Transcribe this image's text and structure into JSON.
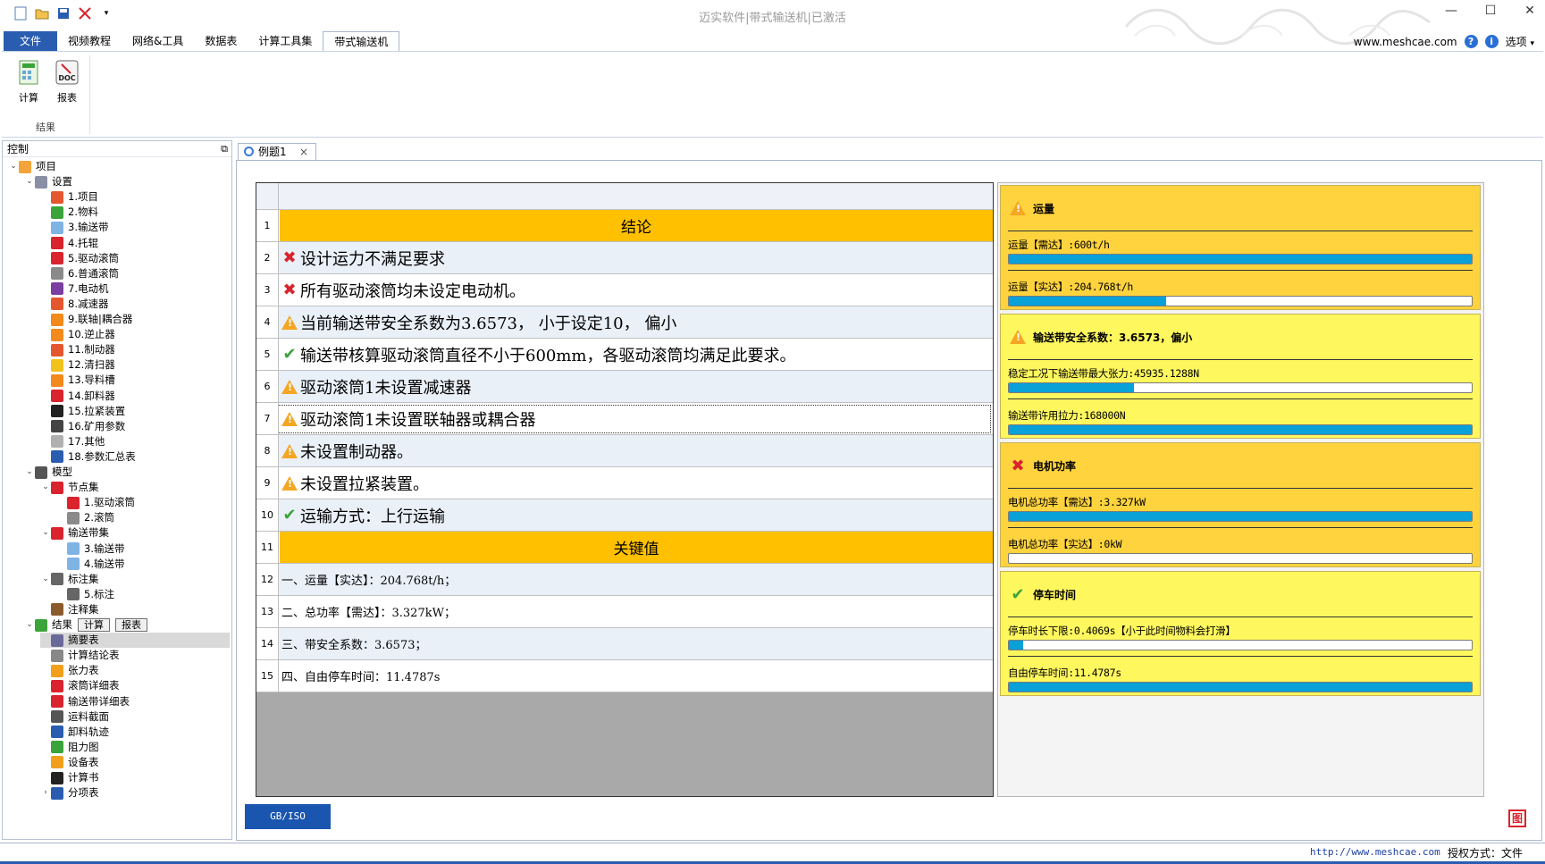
{
  "app_title": "迈实软件|带式输送机|已激活",
  "website": "www.meshcae.com",
  "options_label": "选项",
  "ribbon_tabs": [
    {
      "label": "文件"
    },
    {
      "label": "视频教程"
    },
    {
      "label": "网络&工具"
    },
    {
      "label": "数据表"
    },
    {
      "label": "计算工具集"
    },
    {
      "label": "带式输送机"
    }
  ],
  "ribbon": {
    "calc_label": "计算",
    "report_label": "报表",
    "doc_glyph": "DOC",
    "group_label": "结果"
  },
  "left_panel": {
    "title": "控制",
    "tree": [
      {
        "label": "项目",
        "level": 0,
        "arrow": "v",
        "color": "#f4a43a"
      },
      {
        "label": "设置",
        "level": 1,
        "arrow": "v",
        "color": "#8a8fa6"
      },
      {
        "label": "1.项目",
        "level": 2,
        "color": "#e4572e"
      },
      {
        "label": "2.物料",
        "level": 2,
        "color": "#3aa43a"
      },
      {
        "label": "3.输送带",
        "level": 2,
        "color": "#7fb3e6"
      },
      {
        "label": "4.托辊",
        "level": 2,
        "color": "#d9232d"
      },
      {
        "label": "5.驱动滚筒",
        "level": 2,
        "color": "#d9232d"
      },
      {
        "label": "6.普通滚筒",
        "level": 2,
        "color": "#8a8a8a"
      },
      {
        "label": "7.电动机",
        "level": 2,
        "color": "#7a3fa0"
      },
      {
        "label": "8.减速器",
        "level": 2,
        "color": "#e4572e"
      },
      {
        "label": "9.联轴|耦合器",
        "level": 2,
        "color": "#f28a1c"
      },
      {
        "label": "10.逆止器",
        "level": 2,
        "color": "#f28a1c"
      },
      {
        "label": "11.制动器",
        "level": 2,
        "color": "#e4572e"
      },
      {
        "label": "12.清扫器",
        "level": 2,
        "color": "#f2c21c"
      },
      {
        "label": "13.导料槽",
        "level": 2,
        "color": "#f28a1c"
      },
      {
        "label": "14.卸料器",
        "level": 2,
        "color": "#d9232d"
      },
      {
        "label": "15.拉紧装置",
        "level": 2,
        "color": "#222222"
      },
      {
        "label": "16.矿用参数",
        "level": 2,
        "color": "#444444"
      },
      {
        "label": "17.其他",
        "level": 2,
        "color": "#b0b0b0"
      },
      {
        "label": "18.参数汇总表",
        "level": 2,
        "color": "#2a5db0"
      },
      {
        "label": "模型",
        "level": 1,
        "arrow": "v",
        "color": "#555555"
      },
      {
        "label": "节点集",
        "level": 2,
        "arrow": "v",
        "color": "#d9232d"
      },
      {
        "label": "1.驱动滚筒",
        "level": 3,
        "color": "#d9232d"
      },
      {
        "label": "2.滚筒",
        "level": 3,
        "color": "#8a8a8a"
      },
      {
        "label": "输送带集",
        "level": 2,
        "arrow": "v",
        "color": "#d9232d"
      },
      {
        "label": "3.输送带",
        "level": 3,
        "color": "#7fb3e6"
      },
      {
        "label": "4.输送带",
        "level": 3,
        "color": "#7fb3e6"
      },
      {
        "label": "标注集",
        "level": 2,
        "arrow": "v",
        "color": "#666666"
      },
      {
        "label": "5.标注",
        "level": 3,
        "color": "#666666"
      },
      {
        "label": "注释集",
        "level": 2,
        "color": "#8b5a2b"
      },
      {
        "label": "结果",
        "level": 1,
        "arrow": "v",
        "color": "#3aa43a",
        "buttons": [
          "计算",
          "报表"
        ]
      },
      {
        "label": "摘要表",
        "level": 2,
        "color": "#6a6a9a",
        "selected": true
      },
      {
        "label": "计算结论表",
        "level": 2,
        "color": "#888888"
      },
      {
        "label": "张力表",
        "level": 2,
        "color": "#f2a01c"
      },
      {
        "label": "滚筒详细表",
        "level": 2,
        "color": "#d9232d"
      },
      {
        "label": "输送带详细表",
        "level": 2,
        "color": "#d9232d"
      },
      {
        "label": "运料截面",
        "level": 2,
        "color": "#555555"
      },
      {
        "label": "卸料轨迹",
        "level": 2,
        "color": "#2a5db0"
      },
      {
        "label": "阻力图",
        "level": 2,
        "color": "#3aa43a"
      },
      {
        "label": "设备表",
        "level": 2,
        "color": "#f2a01c"
      },
      {
        "label": "计算书",
        "level": 2,
        "color": "#222222"
      },
      {
        "label": "分项表",
        "level": 2,
        "arrow": ">",
        "color": "#2a5db0"
      }
    ]
  },
  "doc_tab": {
    "label": "例题1",
    "close": "×"
  },
  "grid": {
    "rows": [
      {
        "num": "1",
        "text": "结论",
        "type": "header"
      },
      {
        "num": "2",
        "text": "设计运力不满足要求",
        "icon": "x"
      },
      {
        "num": "3",
        "text": "所有驱动滚筒均未设定电动机。",
        "icon": "x"
      },
      {
        "num": "4",
        "text": "当前输送带安全系数为3.6573， 小于设定10， 偏小",
        "icon": "warn"
      },
      {
        "num": "5",
        "text": "输送带核算驱动滚筒直径不小于600mm，各驱动滚筒均满足此要求。",
        "icon": "check"
      },
      {
        "num": "6",
        "text": "驱动滚筒1未设置减速器",
        "icon": "warn"
      },
      {
        "num": "7",
        "text": "驱动滚筒1未设置联轴器或耦合器",
        "icon": "warn",
        "focus": true
      },
      {
        "num": "8",
        "text": "未设置制动器。",
        "icon": "warn"
      },
      {
        "num": "9",
        "text": "未设置拉紧装置。",
        "icon": "warn"
      },
      {
        "num": "10",
        "text": "运输方式：上行运输",
        "icon": "check"
      },
      {
        "num": "11",
        "text": "关键值",
        "type": "header"
      },
      {
        "num": "12",
        "text": "一、运量【实达】：204.768t/h；",
        "small": true
      },
      {
        "num": "13",
        "text": "二、总功率【需达】：3.327kW；",
        "small": true
      },
      {
        "num": "14",
        "text": "三、带安全系数：3.6573；",
        "small": true
      },
      {
        "num": "15",
        "text": "四、自由停车时间：11.4787s",
        "small": true
      }
    ]
  },
  "cards": [
    {
      "title": "运量",
      "icon": "warn",
      "color": "orange",
      "items": [
        {
          "label": "运量【需达】:600t/h",
          "fraction": 1.0
        },
        {
          "label": "运量【实达】:204.768t/h",
          "fraction": 0.34
        }
      ]
    },
    {
      "title": "输送带安全系数：3.6573，偏小",
      "icon": "warn",
      "color": "yellow",
      "items": [
        {
          "label": "稳定工况下输送带最大张力:45935.1288N",
          "fraction": 0.27
        },
        {
          "label": "输送带许用拉力:168000N",
          "fraction": 1.0
        }
      ]
    },
    {
      "title": "电机功率",
      "icon": "x",
      "color": "orange",
      "items": [
        {
          "label": "电机总功率【需达】:3.327kW",
          "fraction": 1.0
        },
        {
          "label": "电机总功率【实达】:0kW",
          "fraction": 0.0
        }
      ]
    },
    {
      "title": "停车时间",
      "icon": "check",
      "color": "yellow",
      "items": [
        {
          "label": "停车时长下限:0.4069s【小于此时间物料会打滑】",
          "fraction": 0.03
        },
        {
          "label": "自由停车时间:11.4787s",
          "fraction": 1.0
        }
      ]
    }
  ],
  "bottom": {
    "standard_label": "GB/ISO",
    "image_glyph": "图"
  },
  "status": {
    "url": "http://www.meshcae.com",
    "license": "授权方式：文件"
  },
  "colors": {
    "accent": "#2a5db0",
    "header_row": "#ffc000",
    "bar": "#0aa0d8",
    "card_orange": "#ffd33d",
    "card_yellow": "#fff75e"
  }
}
